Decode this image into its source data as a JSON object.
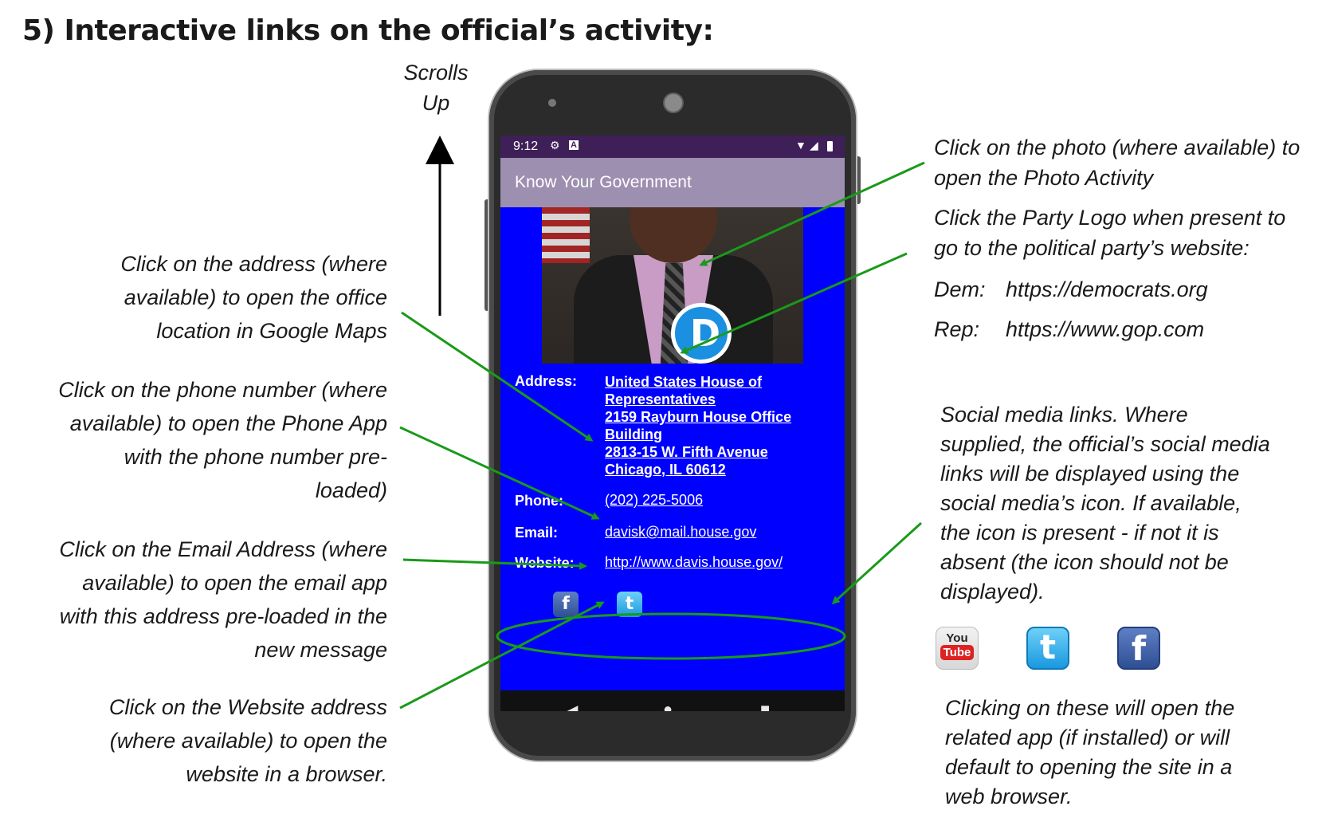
{
  "heading": "5)  Interactive links on the official’s activity:",
  "scrolls": {
    "line1": "Scrolls",
    "line2": "Up"
  },
  "left_notes": {
    "address": [
      "Click on the address (where",
      "available) to open the office",
      "location in Google Maps"
    ],
    "phone": [
      "Click on the phone number (where",
      "available) to open the Phone App",
      "with the phone number pre-",
      "loaded)"
    ],
    "email": [
      "Click on the Email Address (where",
      "available) to open the email app",
      "with this address pre-loaded in the",
      "new message"
    ],
    "website": [
      "Click on the Website address",
      "(where available) to open the",
      "website in a browser."
    ]
  },
  "right_notes": {
    "photo": [
      "Click on the photo (where available) to",
      "open the Photo Activity"
    ],
    "party": [
      "Click the Party Logo when present to",
      "go to the political party’s website:"
    ],
    "dem_label": "Dem:",
    "dem_url": "https://democrats.org",
    "rep_label": "Rep:",
    "rep_url": "https://www.gop.com",
    "social": [
      "Social media links. Where",
      "supplied, the official’s social media",
      "links will be displayed using the",
      "social media’s icon. If available,",
      "the icon is present - if not it is",
      "absent (the icon should not be",
      "displayed)."
    ],
    "clicking": [
      "Clicking on these will open the",
      "related app (if installed) or will",
      "default to opening the site in a",
      "web browser."
    ]
  },
  "right_icons": [
    {
      "name": "youtube-icon",
      "line1": "You",
      "line2": "Tube"
    },
    {
      "name": "twitter-icon",
      "glyph": "t"
    },
    {
      "name": "facebook-icon",
      "glyph": "f"
    }
  ],
  "phone": {
    "status": {
      "time": "9:12",
      "settings_icon": "gear-icon",
      "notification_icon": "a-icon",
      "wifi_icon": "wifi-icon",
      "signal_icon": "signal-icon",
      "battery_icon": "battery-icon"
    },
    "app_title": "Know Your Government",
    "party_logo": "D",
    "address_label": "Address:",
    "address_lines": [
      "United States House of",
      "Representatives",
      "2159 Rayburn House Office",
      "Building",
      "2813-15 W. Fifth Avenue",
      "Chicago, IL 60612"
    ],
    "phone_label": "Phone:",
    "phone_value": "(202) 225-5006",
    "email_label": "Email:",
    "email_value": "davisk@mail.house.gov",
    "website_label": "Website:",
    "website_value": "http://www.davis.house.gov/",
    "social_icons": [
      {
        "name": "facebook-icon",
        "glyph": "f",
        "color": "#3b5998"
      },
      {
        "name": "twitter-icon",
        "glyph": "t",
        "color": "#33aaf0"
      }
    ],
    "nav": {
      "back": "◀",
      "home": "●",
      "recents": "■"
    }
  },
  "colors": {
    "annotation_arrow": "#1a9a1a",
    "screen_bg": "#0000ff",
    "status_bar": "#3f1f58",
    "app_bar": "#9c8fb0"
  }
}
